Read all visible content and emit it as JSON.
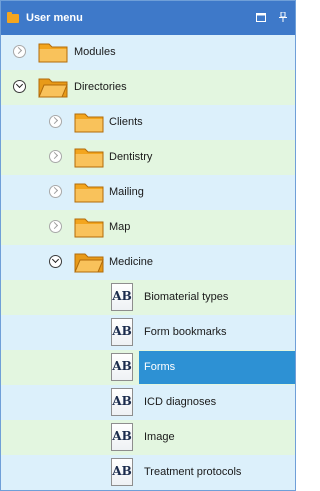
{
  "header": {
    "title": "User menu",
    "pin_icon": "pin-icon",
    "minimize_icon": "restore-icon",
    "accent": "#3e79c9"
  },
  "tree": {
    "modules": {
      "label": "Modules"
    },
    "directories": {
      "label": "Directories",
      "children": {
        "clients": {
          "label": "Clients"
        },
        "dentistry": {
          "label": "Dentistry"
        },
        "mailing": {
          "label": "Mailing"
        },
        "map": {
          "label": "Map"
        },
        "medicine": {
          "label": "Medicine",
          "children": [
            {
              "label": "Biomaterial types",
              "icon_text": "AB"
            },
            {
              "label": "Form bookmarks",
              "icon_text": "AB"
            },
            {
              "label": "Forms",
              "icon_text": "AB",
              "selected": true
            },
            {
              "label": "ICD diagnoses",
              "icon_text": "AB"
            },
            {
              "label": "Image",
              "icon_text": "AB"
            },
            {
              "label": "Treatment protocols",
              "icon_text": "AB"
            }
          ]
        }
      }
    }
  },
  "colors": {
    "selection": "#2d91d4",
    "row_even": "#dcf0fb",
    "row_odd": "#e3f6e0",
    "folder": "#f3a51e"
  }
}
